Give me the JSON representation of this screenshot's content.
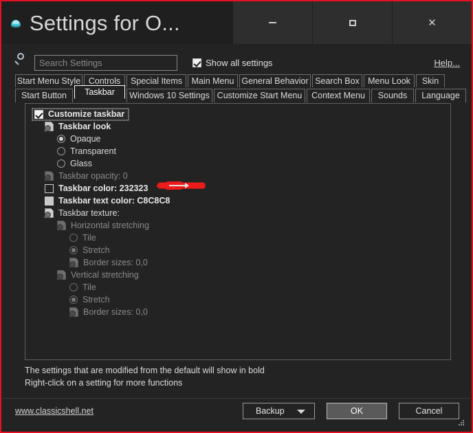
{
  "window": {
    "title": "Settings for O...",
    "icon": "classic-shell-icon",
    "border_color": "#e81123",
    "background": "#232323"
  },
  "caption_buttons": [
    {
      "name": "minimize",
      "glyph": "minimize-icon"
    },
    {
      "name": "maximize",
      "glyph": "maximize-icon"
    },
    {
      "name": "close",
      "glyph": "close-icon"
    }
  ],
  "search": {
    "icon": "search-icon",
    "placeholder": "Search Settings",
    "value": ""
  },
  "show_all": {
    "label": "Show all settings",
    "checked": true
  },
  "help": {
    "label": "Help..."
  },
  "tabs": {
    "row1": [
      {
        "label": "Start Menu Style",
        "width": 98,
        "selected": false
      },
      {
        "label": "Controls",
        "width": 60,
        "selected": false
      },
      {
        "label": "Special Items",
        "width": 87,
        "selected": false
      },
      {
        "label": "Main Menu",
        "width": 73,
        "selected": false
      },
      {
        "label": "General Behavior",
        "width": 104,
        "selected": false
      },
      {
        "label": "Search Box",
        "width": 73,
        "selected": false
      },
      {
        "label": "Menu Look",
        "width": 74,
        "selected": false
      },
      {
        "label": "Skin",
        "width": 42,
        "selected": false
      }
    ],
    "row2": [
      {
        "label": "Start Button",
        "width": 84,
        "selected": false
      },
      {
        "label": "Taskbar",
        "width": 74,
        "selected": true
      },
      {
        "label": "Windows 10 Settings",
        "width": 125,
        "selected": false
      },
      {
        "label": "Customize Start Menu",
        "width": 133,
        "selected": false
      },
      {
        "label": "Context Menu",
        "width": 92,
        "selected": false
      },
      {
        "label": "Sounds",
        "width": 62,
        "selected": false
      },
      {
        "label": "Language",
        "width": 74,
        "selected": false
      }
    ]
  },
  "tree": [
    {
      "type": "checkbox",
      "label": "Customize taskbar",
      "indent": 0,
      "checked": true,
      "bold": true,
      "focused": true,
      "dim": false
    },
    {
      "type": "page",
      "label": "Taskbar look",
      "indent": 1,
      "bold": true,
      "dim": false
    },
    {
      "type": "radio",
      "label": "Opaque",
      "indent": 2,
      "selected": true,
      "bold": false,
      "dim": false
    },
    {
      "type": "radio",
      "label": "Transparent",
      "indent": 2,
      "selected": false,
      "bold": false,
      "dim": false
    },
    {
      "type": "radio",
      "label": "Glass",
      "indent": 2,
      "selected": false,
      "bold": false,
      "dim": false
    },
    {
      "type": "page",
      "label": "Taskbar opacity: 0",
      "indent": 1,
      "bold": false,
      "dim": true
    },
    {
      "type": "swatch",
      "label": "Taskbar color: 232323",
      "indent": 1,
      "color": "#232323",
      "bold": true,
      "dim": false
    },
    {
      "type": "swatch",
      "label": "Taskbar text color: C8C8C8",
      "indent": 1,
      "color": "#c8c8c8",
      "bold": true,
      "dim": false
    },
    {
      "type": "page",
      "label": "Taskbar texture:",
      "indent": 1,
      "bold": false,
      "dim": false
    },
    {
      "type": "page",
      "label": "Horizontal stretching",
      "indent": 2,
      "bold": false,
      "dim": true
    },
    {
      "type": "radio",
      "label": "Tile",
      "indent": 3,
      "selected": false,
      "bold": false,
      "dim": true
    },
    {
      "type": "radio",
      "label": "Stretch",
      "indent": 3,
      "selected": true,
      "bold": false,
      "dim": true
    },
    {
      "type": "page",
      "label": "Border sizes: 0,0",
      "indent": 3,
      "bold": false,
      "dim": true
    },
    {
      "type": "page",
      "label": "Vertical stretching",
      "indent": 2,
      "bold": false,
      "dim": true
    },
    {
      "type": "radio",
      "label": "Tile",
      "indent": 3,
      "selected": false,
      "bold": false,
      "dim": true
    },
    {
      "type": "radio",
      "label": "Stretch",
      "indent": 3,
      "selected": true,
      "bold": false,
      "dim": true
    },
    {
      "type": "page",
      "label": "Border sizes: 0,0",
      "indent": 3,
      "bold": false,
      "dim": true
    }
  ],
  "notes": [
    "The settings that are modified from the default will show in bold",
    "Right-click on a setting for more functions"
  ],
  "footer": {
    "site_link": "www.classicshell.net",
    "buttons": [
      {
        "name": "backup",
        "label": "Backup",
        "has_caret": true,
        "default": false
      },
      {
        "name": "ok",
        "label": "OK",
        "has_caret": false,
        "default": true
      },
      {
        "name": "cancel",
        "label": "Cancel",
        "has_caret": false,
        "default": false
      }
    ],
    "resize_grip": "resize-grip-icon"
  },
  "annotation": {
    "color": "#ec1c1c",
    "shape": "arrow-pointing-right"
  }
}
